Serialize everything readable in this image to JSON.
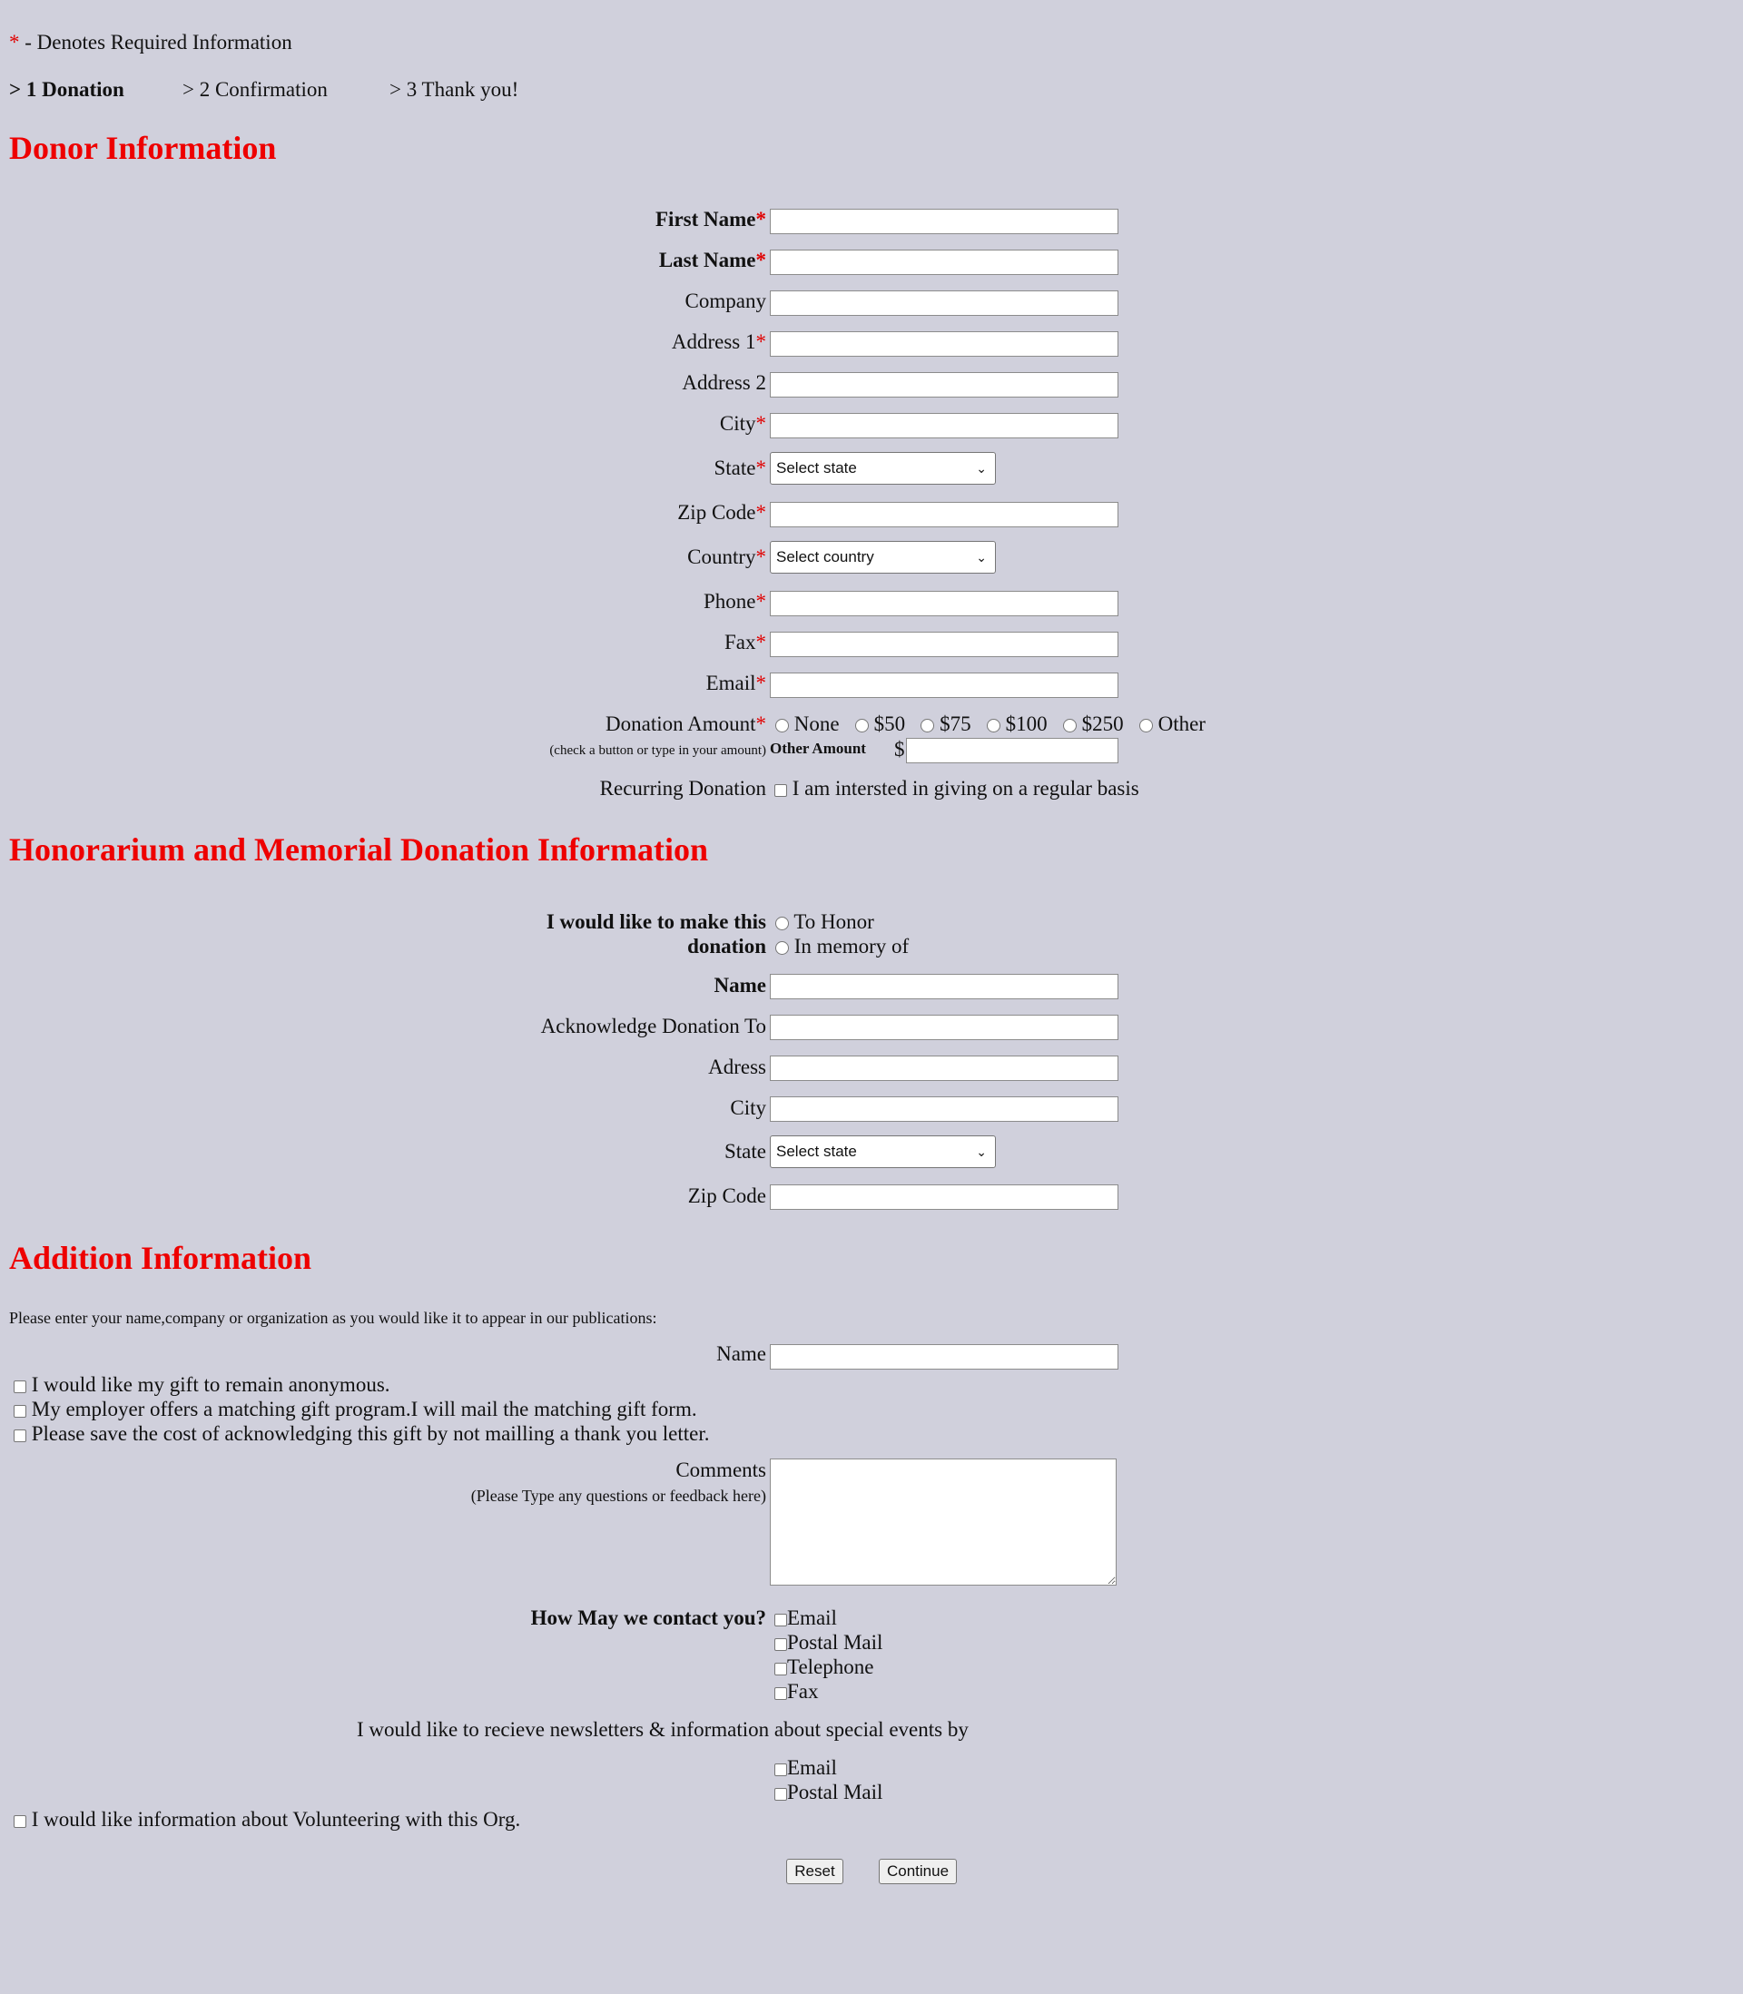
{
  "legend": {
    "asterisk": "*",
    "text": " - Denotes Required Information"
  },
  "steps": [
    "> 1 Donation",
    "> 2 Confirmation",
    "> 3 Thank you!"
  ],
  "required_mark": "*",
  "donor": {
    "heading": "Donor Information",
    "first_name": "First Name",
    "last_name": "Last Name",
    "company": "Company",
    "address1": "Address 1",
    "address2": "Address 2",
    "city": "City",
    "state": "State",
    "state_placeholder": "Select state",
    "zip": "Zip Code",
    "country": "Country",
    "country_placeholder": "Select country",
    "phone": "Phone",
    "fax": "Fax",
    "email": "Email",
    "donation_amount": "Donation Amount",
    "donation_hint": "(check a button or type in your amount)",
    "amount_options": [
      "None",
      "$50",
      "$75",
      "$100",
      "$250",
      "Other"
    ],
    "other_amount": "Other Amount",
    "currency": "$",
    "recurring": "Recurring Donation",
    "recurring_option": "I am intersted in giving on a regular basis"
  },
  "honor": {
    "heading": "Honorarium and Memorial Donation Information",
    "make_line1": "I would like to make this",
    "make_line2": "donation",
    "options": [
      "To Honor",
      "In memory of"
    ],
    "name": "Name",
    "ack": "Acknowledge Donation To",
    "address": "Adress",
    "city": "City",
    "state": "State",
    "state_placeholder": "Select state",
    "zip": "Zip Code"
  },
  "addition": {
    "heading": "Addition Information",
    "intro": "Please enter your name,company or organization as you would like it to appear in our publications:",
    "name": "Name",
    "checks": [
      "I would like my gift to remain anonymous.",
      "My employer offers a matching gift program.I will mail the matching gift form.",
      "Please save the cost of acknowledging this gift by not mailling a thank you letter."
    ],
    "comments": "Comments",
    "comments_hint": "(Please Type any questions or feedback here)",
    "contact_question": "How May we contact you?",
    "contact_options": [
      "Email",
      "Postal Mail",
      "Telephone",
      "Fax"
    ],
    "newsletter": "I would like to recieve newsletters & information about special events by",
    "newsletter_options": [
      "Email",
      "Postal Mail"
    ],
    "volunteer": "I would like information about Volunteering with this Org."
  },
  "buttons": {
    "reset": "Reset",
    "continue": "Continue"
  }
}
